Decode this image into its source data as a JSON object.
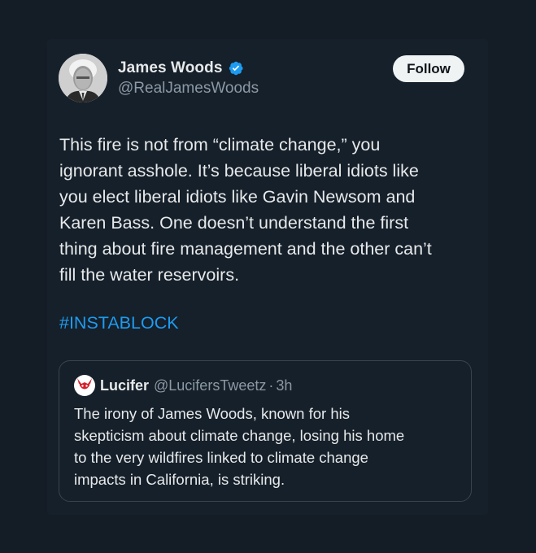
{
  "tweet": {
    "author": {
      "display_name": "James Woods",
      "handle": "@RealJamesWoods",
      "verified": true
    },
    "follow_label": "Follow",
    "text": "This fire is not from “climate change,” you\nignorant asshole. It’s because liberal idiots like\nyou elect liberal idiots like Gavin Newsom and\nKaren Bass. One doesn’t understand the first\nthing about fire management and the other can’t\nfill the water reservoirs.",
    "hashtag": "#INSTABLOCK"
  },
  "quoted": {
    "display_name": "Lucifer",
    "handle": "@LucifersTweetz",
    "separator": "·",
    "time": "3h",
    "text": "The irony of James Woods, known for his\nskepticism about climate change, losing his home\nto the very wildfires linked to climate change\nimpacts in California, is striking."
  },
  "colors": {
    "background": "#141d26",
    "card": "#16202a",
    "text_primary": "#e7e9ea",
    "text_secondary": "#8b98a5",
    "link": "#1d9bf0",
    "verified_badge": "#1d9bf0",
    "border": "#38444d"
  },
  "icons": {
    "verified": "verified-badge-icon",
    "quoted_avatar": "red-devil-avatar"
  }
}
